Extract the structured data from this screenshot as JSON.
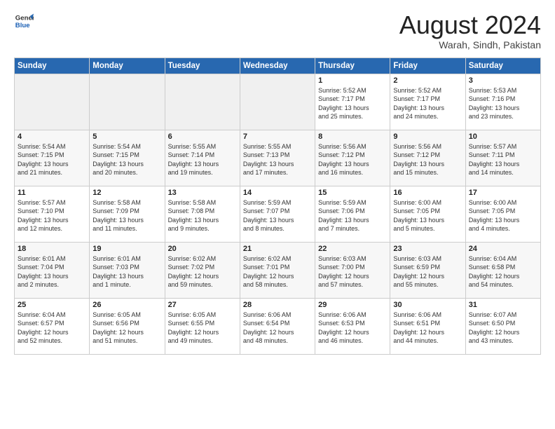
{
  "header": {
    "logo_line1": "General",
    "logo_line2": "Blue",
    "month": "August 2024",
    "location": "Warah, Sindh, Pakistan"
  },
  "days_of_week": [
    "Sunday",
    "Monday",
    "Tuesday",
    "Wednesday",
    "Thursday",
    "Friday",
    "Saturday"
  ],
  "weeks": [
    [
      {
        "num": "",
        "info": ""
      },
      {
        "num": "",
        "info": ""
      },
      {
        "num": "",
        "info": ""
      },
      {
        "num": "",
        "info": ""
      },
      {
        "num": "1",
        "info": "Sunrise: 5:52 AM\nSunset: 7:17 PM\nDaylight: 13 hours\nand 25 minutes."
      },
      {
        "num": "2",
        "info": "Sunrise: 5:52 AM\nSunset: 7:17 PM\nDaylight: 13 hours\nand 24 minutes."
      },
      {
        "num": "3",
        "info": "Sunrise: 5:53 AM\nSunset: 7:16 PM\nDaylight: 13 hours\nand 23 minutes."
      }
    ],
    [
      {
        "num": "4",
        "info": "Sunrise: 5:54 AM\nSunset: 7:15 PM\nDaylight: 13 hours\nand 21 minutes."
      },
      {
        "num": "5",
        "info": "Sunrise: 5:54 AM\nSunset: 7:15 PM\nDaylight: 13 hours\nand 20 minutes."
      },
      {
        "num": "6",
        "info": "Sunrise: 5:55 AM\nSunset: 7:14 PM\nDaylight: 13 hours\nand 19 minutes."
      },
      {
        "num": "7",
        "info": "Sunrise: 5:55 AM\nSunset: 7:13 PM\nDaylight: 13 hours\nand 17 minutes."
      },
      {
        "num": "8",
        "info": "Sunrise: 5:56 AM\nSunset: 7:12 PM\nDaylight: 13 hours\nand 16 minutes."
      },
      {
        "num": "9",
        "info": "Sunrise: 5:56 AM\nSunset: 7:12 PM\nDaylight: 13 hours\nand 15 minutes."
      },
      {
        "num": "10",
        "info": "Sunrise: 5:57 AM\nSunset: 7:11 PM\nDaylight: 13 hours\nand 14 minutes."
      }
    ],
    [
      {
        "num": "11",
        "info": "Sunrise: 5:57 AM\nSunset: 7:10 PM\nDaylight: 13 hours\nand 12 minutes."
      },
      {
        "num": "12",
        "info": "Sunrise: 5:58 AM\nSunset: 7:09 PM\nDaylight: 13 hours\nand 11 minutes."
      },
      {
        "num": "13",
        "info": "Sunrise: 5:58 AM\nSunset: 7:08 PM\nDaylight: 13 hours\nand 9 minutes."
      },
      {
        "num": "14",
        "info": "Sunrise: 5:59 AM\nSunset: 7:07 PM\nDaylight: 13 hours\nand 8 minutes."
      },
      {
        "num": "15",
        "info": "Sunrise: 5:59 AM\nSunset: 7:06 PM\nDaylight: 13 hours\nand 7 minutes."
      },
      {
        "num": "16",
        "info": "Sunrise: 6:00 AM\nSunset: 7:05 PM\nDaylight: 13 hours\nand 5 minutes."
      },
      {
        "num": "17",
        "info": "Sunrise: 6:00 AM\nSunset: 7:05 PM\nDaylight: 13 hours\nand 4 minutes."
      }
    ],
    [
      {
        "num": "18",
        "info": "Sunrise: 6:01 AM\nSunset: 7:04 PM\nDaylight: 13 hours\nand 2 minutes."
      },
      {
        "num": "19",
        "info": "Sunrise: 6:01 AM\nSunset: 7:03 PM\nDaylight: 13 hours\nand 1 minute."
      },
      {
        "num": "20",
        "info": "Sunrise: 6:02 AM\nSunset: 7:02 PM\nDaylight: 12 hours\nand 59 minutes."
      },
      {
        "num": "21",
        "info": "Sunrise: 6:02 AM\nSunset: 7:01 PM\nDaylight: 12 hours\nand 58 minutes."
      },
      {
        "num": "22",
        "info": "Sunrise: 6:03 AM\nSunset: 7:00 PM\nDaylight: 12 hours\nand 57 minutes."
      },
      {
        "num": "23",
        "info": "Sunrise: 6:03 AM\nSunset: 6:59 PM\nDaylight: 12 hours\nand 55 minutes."
      },
      {
        "num": "24",
        "info": "Sunrise: 6:04 AM\nSunset: 6:58 PM\nDaylight: 12 hours\nand 54 minutes."
      }
    ],
    [
      {
        "num": "25",
        "info": "Sunrise: 6:04 AM\nSunset: 6:57 PM\nDaylight: 12 hours\nand 52 minutes."
      },
      {
        "num": "26",
        "info": "Sunrise: 6:05 AM\nSunset: 6:56 PM\nDaylight: 12 hours\nand 51 minutes."
      },
      {
        "num": "27",
        "info": "Sunrise: 6:05 AM\nSunset: 6:55 PM\nDaylight: 12 hours\nand 49 minutes."
      },
      {
        "num": "28",
        "info": "Sunrise: 6:06 AM\nSunset: 6:54 PM\nDaylight: 12 hours\nand 48 minutes."
      },
      {
        "num": "29",
        "info": "Sunrise: 6:06 AM\nSunset: 6:53 PM\nDaylight: 12 hours\nand 46 minutes."
      },
      {
        "num": "30",
        "info": "Sunrise: 6:06 AM\nSunset: 6:51 PM\nDaylight: 12 hours\nand 44 minutes."
      },
      {
        "num": "31",
        "info": "Sunrise: 6:07 AM\nSunset: 6:50 PM\nDaylight: 12 hours\nand 43 minutes."
      }
    ]
  ]
}
